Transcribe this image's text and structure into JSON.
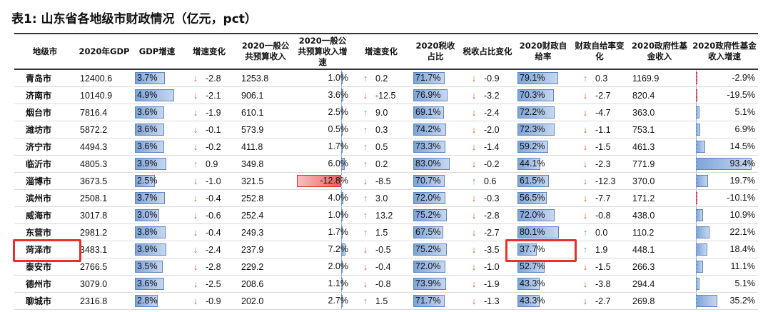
{
  "title": "表1:  山东省各地级市财政情况（亿元，pct）",
  "headers": [
    "地级市",
    "2020年GDP",
    "GDP增速",
    "增速变化",
    "2020一般公共预算收入",
    "2020一般公共预算收入增速",
    "增速变化",
    "2020税收占比",
    "税收占比变化",
    "2020财政自给率",
    "财政自给率变化",
    "2020政府性基金收入",
    "2020政府性基金收入增速"
  ],
  "rows": [
    {
      "city": "青岛市",
      "gdp": "12400.6",
      "gdp_growth": "3.7%",
      "gdp_growth_num": 3.7,
      "growth_chg": "-2.8",
      "growth_chg_dir": "down",
      "budget": "1253.8",
      "budget_growth": "1.0%",
      "budget_growth_num": 1.0,
      "budget_chg": "0.2",
      "budget_chg_dir": "up",
      "tax_share": "71.7%",
      "tax_share_num": 71.7,
      "tax_chg": "-0.9",
      "tax_chg_dir": "down",
      "self_suff": "79.1%",
      "self_suff_num": 79.1,
      "self_chg": "0.3",
      "self_chg_dir": "up",
      "fund": "1169.9",
      "fund_growth": "-2.9%",
      "fund_growth_num": -2.9
    },
    {
      "city": "济南市",
      "gdp": "10140.9",
      "gdp_growth": "4.9%",
      "gdp_growth_num": 4.9,
      "growth_chg": "-2.1",
      "growth_chg_dir": "down",
      "budget": "906.1",
      "budget_growth": "3.6%",
      "budget_growth_num": 3.6,
      "budget_chg": "-12.5",
      "budget_chg_dir": "down",
      "tax_share": "76.9%",
      "tax_share_num": 76.9,
      "tax_chg": "-3.2",
      "tax_chg_dir": "down",
      "self_suff": "70.3%",
      "self_suff_num": 70.3,
      "self_chg": "-2.7",
      "self_chg_dir": "down",
      "fund": "820.4",
      "fund_growth": "-19.5%",
      "fund_growth_num": -19.5
    },
    {
      "city": "烟台市",
      "gdp": "7816.4",
      "gdp_growth": "3.6%",
      "gdp_growth_num": 3.6,
      "growth_chg": "-1.9",
      "growth_chg_dir": "down",
      "budget": "610.1",
      "budget_growth": "2.5%",
      "budget_growth_num": 2.5,
      "budget_chg": "9.0",
      "budget_chg_dir": "up",
      "tax_share": "69.1%",
      "tax_share_num": 69.1,
      "tax_chg": "-2.4",
      "tax_chg_dir": "down",
      "self_suff": "72.2%",
      "self_suff_num": 72.2,
      "self_chg": "-4.7",
      "self_chg_dir": "down",
      "fund": "363.0",
      "fund_growth": "5.1%",
      "fund_growth_num": 5.1
    },
    {
      "city": "潍坊市",
      "gdp": "5872.2",
      "gdp_growth": "3.6%",
      "gdp_growth_num": 3.6,
      "growth_chg": "-0.1",
      "growth_chg_dir": "down",
      "budget": "573.9",
      "budget_growth": "0.5%",
      "budget_growth_num": 0.5,
      "budget_chg": "0.3",
      "budget_chg_dir": "up",
      "tax_share": "74.2%",
      "tax_share_num": 74.2,
      "tax_chg": "-2.0",
      "tax_chg_dir": "down",
      "self_suff": "72.3%",
      "self_suff_num": 72.3,
      "self_chg": "-1.1",
      "self_chg_dir": "down",
      "fund": "753.1",
      "fund_growth": "6.9%",
      "fund_growth_num": 6.9
    },
    {
      "city": "济宁市",
      "gdp": "4494.3",
      "gdp_growth": "3.6%",
      "gdp_growth_num": 3.6,
      "growth_chg": "-0.2",
      "growth_chg_dir": "down",
      "budget": "411.8",
      "budget_growth": "1.7%",
      "budget_growth_num": 1.7,
      "budget_chg": "0.5",
      "budget_chg_dir": "up",
      "tax_share": "73.3%",
      "tax_share_num": 73.3,
      "tax_chg": "-1.4",
      "tax_chg_dir": "down",
      "self_suff": "59.2%",
      "self_suff_num": 59.2,
      "self_chg": "-1.5",
      "self_chg_dir": "down",
      "fund": "461.3",
      "fund_growth": "14.5%",
      "fund_growth_num": 14.5
    },
    {
      "city": "临沂市",
      "gdp": "4805.3",
      "gdp_growth": "3.9%",
      "gdp_growth_num": 3.9,
      "growth_chg": "0.9",
      "growth_chg_dir": "up",
      "budget": "349.8",
      "budget_growth": "6.0%",
      "budget_growth_num": 6.0,
      "budget_chg": "0.2",
      "budget_chg_dir": "up",
      "tax_share": "83.0%",
      "tax_share_num": 83.0,
      "tax_chg": "-0.2",
      "tax_chg_dir": "down",
      "self_suff": "44.1%",
      "self_suff_num": 44.1,
      "self_chg": "-2.3",
      "self_chg_dir": "down",
      "fund": "771.9",
      "fund_growth": "93.4%",
      "fund_growth_num": 93.4
    },
    {
      "city": "淄博市",
      "gdp": "3673.5",
      "gdp_growth": "2.5%",
      "gdp_growth_num": 2.5,
      "growth_chg": "-1.0",
      "growth_chg_dir": "down",
      "budget": "321.5",
      "budget_growth": "-12.8%",
      "budget_growth_num": -12.8,
      "budget_chg": "-8.5",
      "budget_chg_dir": "down",
      "tax_share": "70.7%",
      "tax_share_num": 70.7,
      "tax_chg": "0.6",
      "tax_chg_dir": "up",
      "self_suff": "61.5%",
      "self_suff_num": 61.5,
      "self_chg": "-12.3",
      "self_chg_dir": "down",
      "fund": "370.0",
      "fund_growth": "19.7%",
      "fund_growth_num": 19.7
    },
    {
      "city": "滨州市",
      "gdp": "2508.1",
      "gdp_growth": "3.7%",
      "gdp_growth_num": 3.7,
      "growth_chg": "-0.4",
      "growth_chg_dir": "down",
      "budget": "252.8",
      "budget_growth": "4.0%",
      "budget_growth_num": 4.0,
      "budget_chg": "3.0",
      "budget_chg_dir": "up",
      "tax_share": "72.0%",
      "tax_share_num": 72.0,
      "tax_chg": "-0.3",
      "tax_chg_dir": "down",
      "self_suff": "56.5%",
      "self_suff_num": 56.5,
      "self_chg": "-7.7",
      "self_chg_dir": "down",
      "fund": "171.2",
      "fund_growth": "-10.1%",
      "fund_growth_num": -10.1
    },
    {
      "city": "威海市",
      "gdp": "3017.8",
      "gdp_growth": "3.0%",
      "gdp_growth_num": 3.0,
      "growth_chg": "-0.6",
      "growth_chg_dir": "down",
      "budget": "252.4",
      "budget_growth": "1.0%",
      "budget_growth_num": 1.0,
      "budget_chg": "13.2",
      "budget_chg_dir": "up",
      "tax_share": "75.2%",
      "tax_share_num": 75.2,
      "tax_chg": "-2.8",
      "tax_chg_dir": "down",
      "self_suff": "72.0%",
      "self_suff_num": 72.0,
      "self_chg": "-0.8",
      "self_chg_dir": "down",
      "fund": "438.0",
      "fund_growth": "10.9%",
      "fund_growth_num": 10.9
    },
    {
      "city": "东营市",
      "gdp": "2981.2",
      "gdp_growth": "3.8%",
      "gdp_growth_num": 3.8,
      "growth_chg": "-0.4",
      "growth_chg_dir": "down",
      "budget": "249.3",
      "budget_growth": "1.7%",
      "budget_growth_num": 1.7,
      "budget_chg": "1.5",
      "budget_chg_dir": "up",
      "tax_share": "67.5%",
      "tax_share_num": 67.5,
      "tax_chg": "-2.7",
      "tax_chg_dir": "down",
      "self_suff": "80.1%",
      "self_suff_num": 80.1,
      "self_chg": "0.0",
      "self_chg_dir": "up",
      "fund": "110.2",
      "fund_growth": "22.1%",
      "fund_growth_num": 22.1
    },
    {
      "city": "菏泽市",
      "gdp": "3483.1",
      "gdp_growth": "3.9%",
      "gdp_growth_num": 3.9,
      "growth_chg": "-2.4",
      "growth_chg_dir": "down",
      "budget": "237.9",
      "budget_growth": "7.2%",
      "budget_growth_num": 7.2,
      "budget_chg": "-0.5",
      "budget_chg_dir": "down",
      "tax_share": "75.2%",
      "tax_share_num": 75.2,
      "tax_chg": "-3.5",
      "tax_chg_dir": "down",
      "self_suff": "37.7%",
      "self_suff_num": 37.7,
      "self_chg": "1.9",
      "self_chg_dir": "up",
      "fund": "448.1",
      "fund_growth": "18.4%",
      "fund_growth_num": 18.4
    },
    {
      "city": "泰安市",
      "gdp": "2766.5",
      "gdp_growth": "3.5%",
      "gdp_growth_num": 3.5,
      "growth_chg": "-2.8",
      "growth_chg_dir": "down",
      "budget": "229.2",
      "budget_growth": "2.0%",
      "budget_growth_num": 2.0,
      "budget_chg": "-0.4",
      "budget_chg_dir": "down",
      "tax_share": "72.0%",
      "tax_share_num": 72.0,
      "tax_chg": "-1.0",
      "tax_chg_dir": "down",
      "self_suff": "52.7%",
      "self_suff_num": 52.7,
      "self_chg": "-1.5",
      "self_chg_dir": "down",
      "fund": "266.3",
      "fund_growth": "11.1%",
      "fund_growth_num": 11.1
    },
    {
      "city": "德州市",
      "gdp": "3079.0",
      "gdp_growth": "3.6%",
      "gdp_growth_num": 3.6,
      "growth_chg": "-2.5",
      "growth_chg_dir": "down",
      "budget": "208.6",
      "budget_growth": "1.1%",
      "budget_growth_num": 1.1,
      "budget_chg": "-0.8",
      "budget_chg_dir": "down",
      "tax_share": "73.9%",
      "tax_share_num": 73.9,
      "tax_chg": "-1.9",
      "tax_chg_dir": "down",
      "self_suff": "43.3%",
      "self_suff_num": 43.3,
      "self_chg": "-3.8",
      "self_chg_dir": "down",
      "fund": "294.4",
      "fund_growth": "5.1%",
      "fund_growth_num": 5.1
    },
    {
      "city": "聊城市",
      "gdp": "2316.8",
      "gdp_growth": "2.8%",
      "gdp_growth_num": 2.8,
      "growth_chg": "-0.9",
      "growth_chg_dir": "down",
      "budget": "202.0",
      "budget_growth": "2.7%",
      "budget_growth_num": 2.7,
      "budget_chg": "1.5",
      "budget_chg_dir": "up",
      "tax_share": "71.7%",
      "tax_share_num": 71.7,
      "tax_chg": "-1.3",
      "tax_chg_dir": "down",
      "self_suff": "43.3%",
      "self_suff_num": 43.3,
      "self_chg": "-2.7",
      "self_chg_dir": "down",
      "fund": "269.8",
      "fund_growth": "35.2%",
      "fund_growth_num": 35.2
    }
  ],
  "highlight_city": "菏泽市",
  "colors": {
    "bar": "#7ea4d8",
    "bar_neg": "#e95f5f",
    "up": "#5bb38a",
    "down": "#e0562d",
    "highlight": "#e8302a"
  }
}
